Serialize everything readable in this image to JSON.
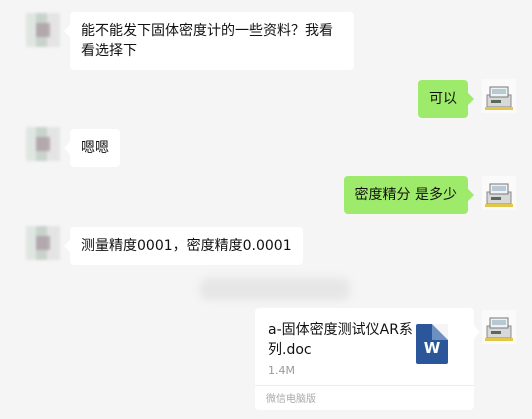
{
  "messages": [
    {
      "side": "in",
      "text": "能不能发下固体密度计的一些资料？我看看选择下"
    },
    {
      "side": "out",
      "text": "可以"
    },
    {
      "side": "in",
      "text": "嗯嗯"
    },
    {
      "side": "out",
      "text": "密度精分 是多少"
    },
    {
      "side": "in",
      "text": "测量精度0001，密度精度0.0001"
    }
  ],
  "file_message": {
    "file_name": "a-固体密度测试仪AR系列.doc",
    "file_size": "1.4M",
    "source": "微信电脑版",
    "file_type_icon": "word-doc-icon",
    "file_type_letter": "W"
  },
  "colors": {
    "background": "#f5f5f5",
    "incoming_bubble": "#ffffff",
    "outgoing_bubble": "#9eea6a",
    "word_icon": "#2b579a"
  }
}
